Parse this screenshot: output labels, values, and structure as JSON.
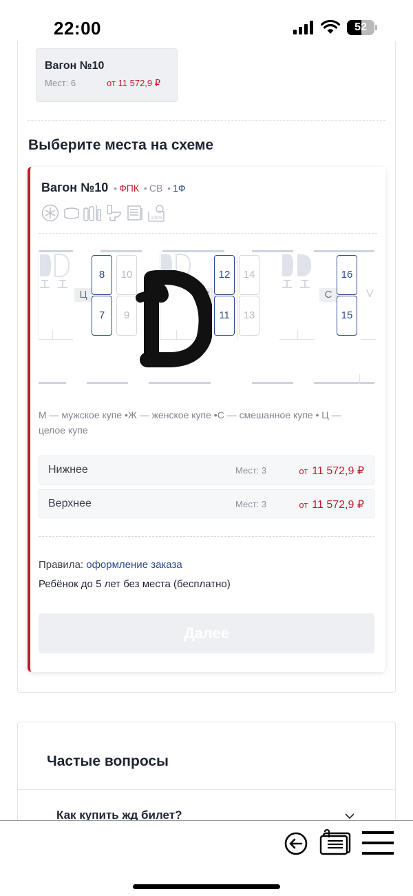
{
  "status_bar": {
    "time": "22:00",
    "battery": "52"
  },
  "selected_wagon_chip": {
    "title": "Вагон №10",
    "seats": "Мест: 6",
    "price": "от  11 572,9 ₽"
  },
  "section_title": "Выберите места на схеме",
  "wagon": {
    "title": "Вагон №10",
    "carrier": "ФПК",
    "class": "СВ",
    "service_class": "1Ф",
    "amenities": [
      "snowflake-icon",
      "towel-icon",
      "hygiene-kit-icon",
      "toilet-icon",
      "newspaper-icon",
      "linen-icon"
    ]
  },
  "scheme": {
    "compartments": [
      {
        "type_label": "Ц",
        "seats": [
          {
            "number": "8",
            "free": true
          },
          {
            "number": "10",
            "free": false
          },
          {
            "number": "7",
            "free": true
          },
          {
            "number": "9",
            "free": false
          }
        ]
      },
      {
        "type_label": "С",
        "seats": [
          {
            "number": "12",
            "free": true
          },
          {
            "number": "14",
            "free": false
          },
          {
            "number": "11",
            "free": true
          },
          {
            "number": "13",
            "free": false
          }
        ]
      },
      {
        "type_label": "С",
        "seats": [
          {
            "number": "16",
            "free": true
          },
          {
            "number": "15",
            "free": true
          }
        ]
      }
    ],
    "partial_label": "V"
  },
  "legend": "М — мужское купе  •Ж — женское купе  •С — смешанное купе  •  Ц — целое купе",
  "berths": [
    {
      "name": "Нижнее",
      "seats": "Мест: 3",
      "price_prefix": "от",
      "price": "11 572,9 ₽"
    },
    {
      "name": "Верхнее",
      "seats": "Мест: 3",
      "price_prefix": "от",
      "price": "11 572,9 ₽"
    }
  ],
  "rules": {
    "label": "Правила:",
    "link": "оформление заказа"
  },
  "child_note": "Ребёнок до 5 лет без места (бесплатно)",
  "next_button": "Далее",
  "faq": {
    "title": "Частые вопросы",
    "question": "Как купить жд билет?"
  },
  "colors": {
    "accent_red": "#c01b2c",
    "navy": "#2b4a8a",
    "text": "#1f2433"
  }
}
